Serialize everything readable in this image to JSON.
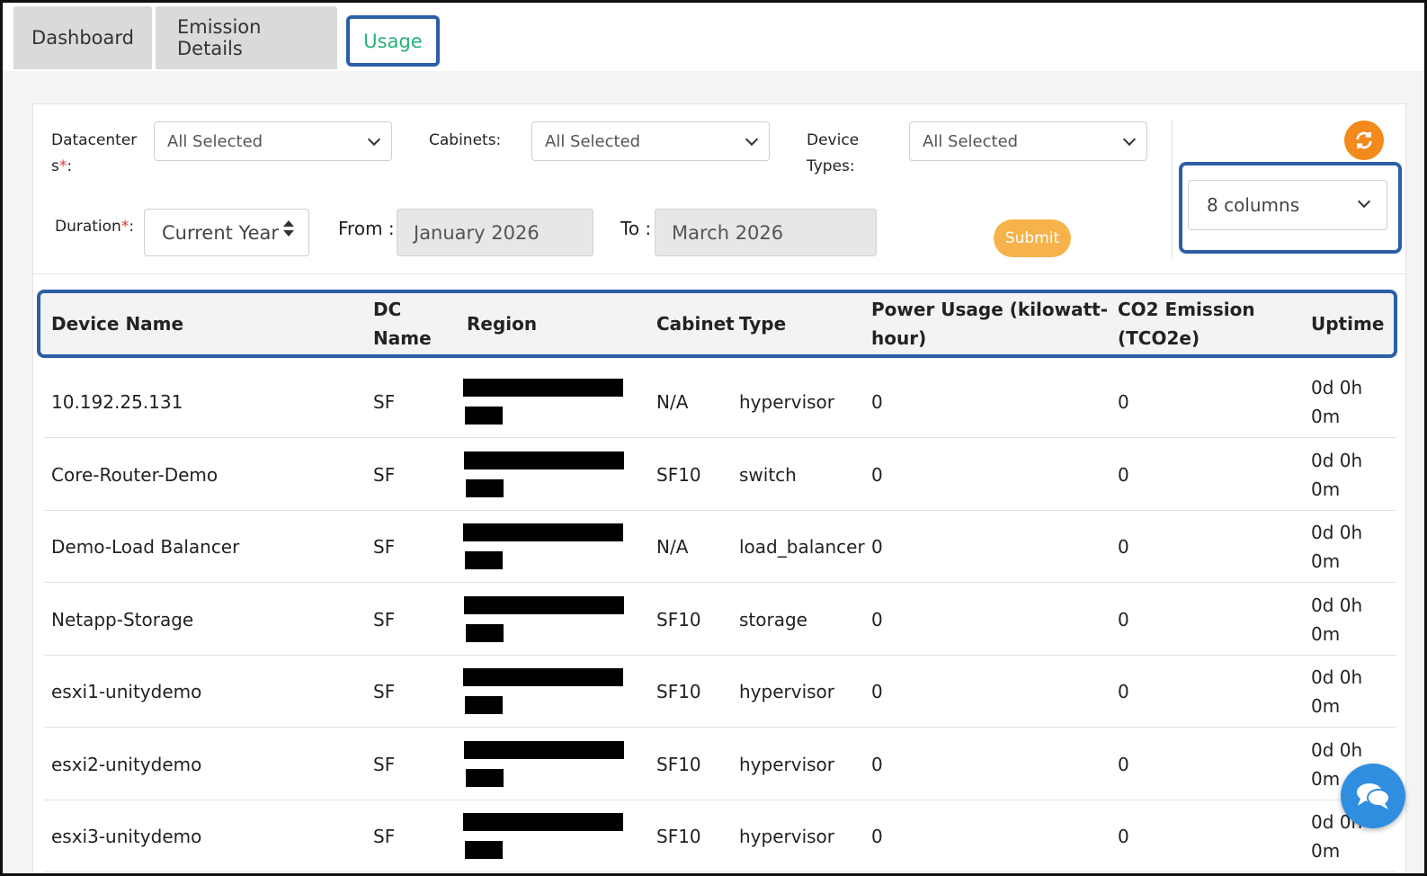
{
  "tabs": [
    {
      "label": "Dashboard"
    },
    {
      "label": "Emission Details"
    },
    {
      "label": "Usage"
    }
  ],
  "filters": {
    "datacenters_label_1": "Datacenter",
    "datacenters_label_2": "s",
    "datacenters_req": "*",
    "datacenters_label_3": ":",
    "datacenters_value": "All Selected",
    "cabinets_label": "Cabinets:",
    "cabinets_value": "All Selected",
    "device_types_label_1": "Device",
    "device_types_label_2": "Types:",
    "device_types_value": "All Selected",
    "duration_label": "Duration",
    "duration_req": "*",
    "duration_colon": ":",
    "duration_value": "Current Year",
    "from_label": "From :",
    "from_value": "January 2026",
    "to_label": "To :",
    "to_value": "March 2026",
    "submit_label": "Submit",
    "columns_value": "8 columns"
  },
  "table": {
    "headers": {
      "device_name": "Device Name",
      "dc_name_1": "DC",
      "dc_name_2": "Name",
      "region": "Region",
      "cabinet": "Cabinet",
      "type": "Type",
      "power_1": "Power Usage (kilowatt-",
      "power_2": "hour)",
      "co2_1": "CO2 Emission",
      "co2_2": "(TCO2e)",
      "uptime": "Uptime"
    },
    "rows": [
      {
        "device": "10.192.25.131",
        "dc": "SF",
        "cabinet": "N/A",
        "type": "hypervisor",
        "power": "0",
        "co2": "0",
        "uptime_1": "0d 0h",
        "uptime_2": "0m"
      },
      {
        "device": "Core-Router-Demo",
        "dc": "SF",
        "cabinet": "SF10",
        "type": "switch",
        "power": "0",
        "co2": "0",
        "uptime_1": "0d 0h",
        "uptime_2": "0m"
      },
      {
        "device": "Demo-Load Balancer",
        "dc": "SF",
        "cabinet": "N/A",
        "type": "load_balancer",
        "power": "0",
        "co2": "0",
        "uptime_1": "0d 0h",
        "uptime_2": "0m"
      },
      {
        "device": "Netapp-Storage",
        "dc": "SF",
        "cabinet": "SF10",
        "type": "storage",
        "power": "0",
        "co2": "0",
        "uptime_1": "0d 0h",
        "uptime_2": "0m"
      },
      {
        "device": "esxi1-unitydemo",
        "dc": "SF",
        "cabinet": "SF10",
        "type": "hypervisor",
        "power": "0",
        "co2": "0",
        "uptime_1": "0d 0h",
        "uptime_2": "0m"
      },
      {
        "device": "esxi2-unitydemo",
        "dc": "SF",
        "cabinet": "SF10",
        "type": "hypervisor",
        "power": "0",
        "co2": "0",
        "uptime_1": "0d 0h",
        "uptime_2": "0m"
      },
      {
        "device": "esxi3-unitydemo",
        "dc": "SF",
        "cabinet": "SF10",
        "type": "hypervisor",
        "power": "0",
        "co2": "0",
        "uptime_1": "0d 0h",
        "uptime_2": "0m"
      }
    ]
  },
  "colors": {
    "active_tab_text": "#26b07a",
    "highlight_border": "#2c5fa8",
    "submit_bg": "#f7b34b",
    "refresh_bg": "#f28a1c",
    "chat_bg": "#2f8ee0"
  }
}
